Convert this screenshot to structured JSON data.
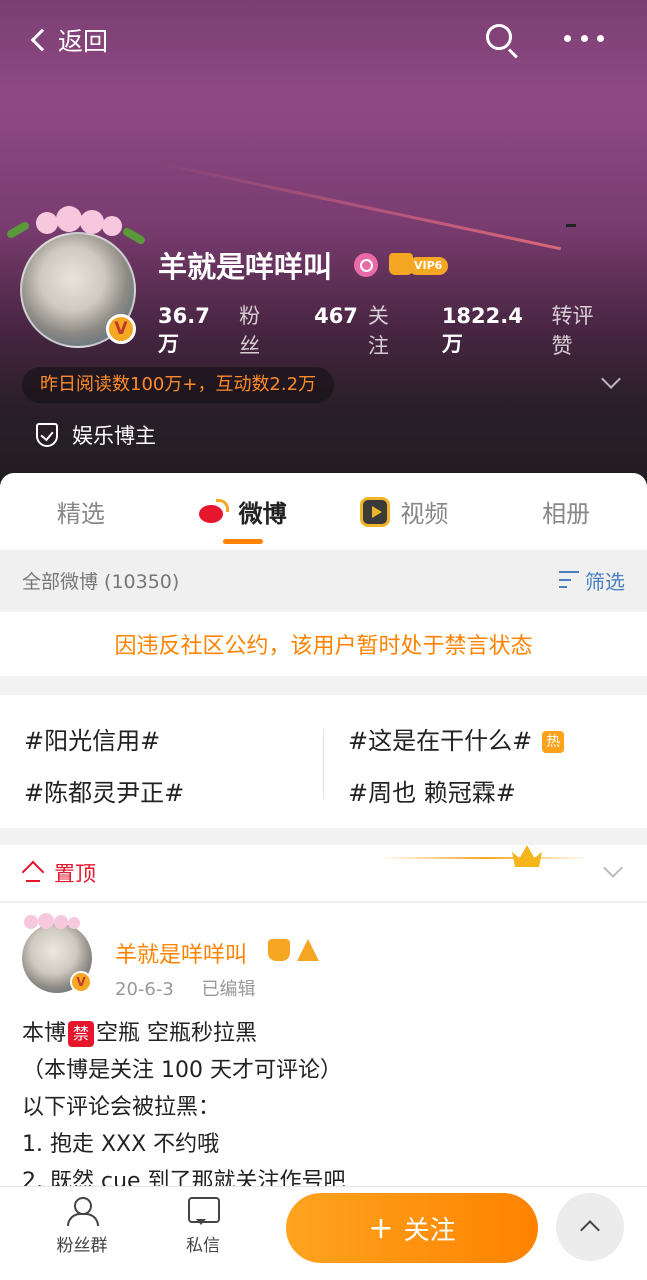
{
  "header": {
    "back_label": "返回",
    "search_icon": "search-icon",
    "more_icon": "more-icon"
  },
  "profile": {
    "name": "羊就是咩咩叫",
    "vip_label": "VIP6",
    "stats": [
      {
        "value": "36.7万",
        "label": "粉丝"
      },
      {
        "value": "467",
        "label": "关注"
      },
      {
        "value": "1822.4万",
        "label": "转评赞"
      }
    ],
    "read_summary": "昨日阅读数100万+，互动数2.2万",
    "tagline": "娱乐博主",
    "verified_glyph": "V"
  },
  "tabs": [
    {
      "label": "精选",
      "active": false
    },
    {
      "label": "微博",
      "active": true
    },
    {
      "label": "视频",
      "active": false
    },
    {
      "label": "相册",
      "active": false
    }
  ],
  "filter": {
    "count_label": "全部微博 (10350)",
    "filter_label": "筛选"
  },
  "notice": "因违反社区公约，该用户暂时处于禁言状态",
  "topics": [
    {
      "text": "#阳光信用#"
    },
    {
      "text": "#这是在干什么#",
      "badge": "热"
    },
    {
      "text": "#陈都灵尹正#"
    },
    {
      "text": "#周也 赖冠霖#"
    }
  ],
  "pinned": {
    "label": "置顶"
  },
  "post": {
    "author": "羊就是咩咩叫",
    "date": "20-6-3",
    "edited": "已编辑",
    "lines": {
      "l1_prefix": "本博",
      "l1_badge": "禁",
      "l1_suffix": "空瓶  空瓶秒拉黑",
      "l2": "（本博是关注 100 天才可评论）",
      "l3": "以下评论会被拉黑：",
      "l4": "1. 抱走 XXX 不约哦",
      "l5": "2. 既然 cue 到了那就关注作号吧"
    }
  },
  "bottom_bar": {
    "fans_group": "粉丝群",
    "message": "私信",
    "follow": "关注",
    "follow_plus": "+"
  }
}
